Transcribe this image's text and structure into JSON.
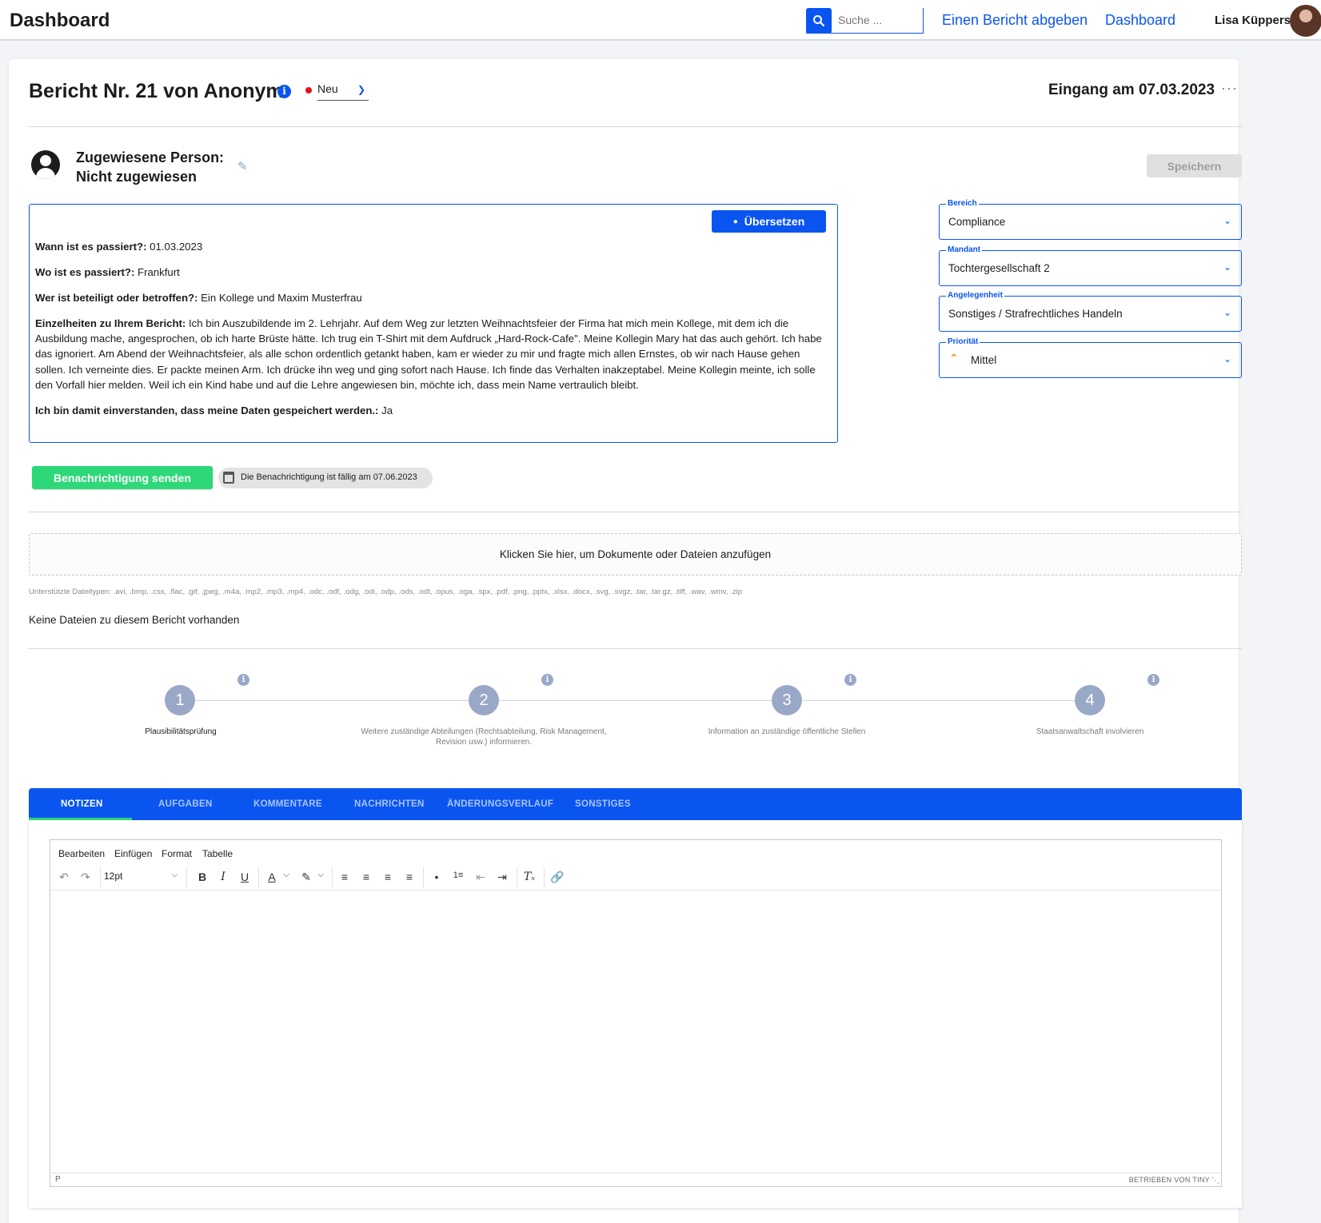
{
  "header": {
    "title": "Dashboard",
    "search_placeholder": "Suche ...",
    "nav": [
      "Einen Bericht abgeben",
      "Dashboard"
    ],
    "user_name": "Lisa Küppers"
  },
  "report": {
    "title": "Bericht Nr. 21 von Anonym",
    "status": "Neu",
    "received": "Eingang am 07.03.2023",
    "assigned_line1": "Zugewiesene Person:",
    "assigned_line2": "Nicht zugewiesen",
    "save_label": "Speichern",
    "translate_label": "Übersetzen",
    "fields": [
      {
        "label": "Wann ist es passiert?:",
        "value": " 01.03.2023"
      },
      {
        "label": "Wo ist es passiert?:",
        "value": " Frankfurt"
      },
      {
        "label": "Wer ist beteiligt oder betroffen?:",
        "value": " Ein Kollege und Maxim Musterfrau"
      },
      {
        "label": "Einzelheiten zu Ihrem Bericht:",
        "value": " Ich bin Auszubildende im 2. Lehrjahr. Auf dem Weg zur letzten Weihnachtsfeier der Firma hat mich mein Kollege, mit dem ich die Ausbildung mache, angesprochen, ob ich harte Brüste hätte. Ich trug ein T-Shirt mit dem Aufdruck „Hard-Rock-Cafe\". Meine Kollegin Mary hat das auch gehört. Ich habe das ignoriert. Am Abend der Weihnachtsfeier, als alle schon ordentlich getankt haben, kam er wieder zu mir und fragte mich allen Ernstes, ob wir nach Hause gehen sollen. Ich verneinte dies. Er packte meinen Arm. Ich drücke ihn weg und ging sofort nach Hause. Ich finde das Verhalten inakzeptabel. Meine Kollegin meinte, ich solle den Vorfall hier melden. Weil ich ein Kind habe und auf die Lehre angewiesen bin, möchte ich, dass mein Name vertraulich bleibt."
      },
      {
        "label": "Ich bin damit einverstanden, dass meine Daten gespeichert werden.:",
        "value": " Ja"
      }
    ]
  },
  "meta_fields": [
    {
      "label": "Bereich",
      "value": "Compliance"
    },
    {
      "label": "Mandant",
      "value": "Tochtergesellschaft 2"
    },
    {
      "label": "Angelegenheit",
      "value": "Sonstiges / Strafrechtliches Handeln"
    },
    {
      "label": "Priorität",
      "value": "Mittel"
    }
  ],
  "notification": {
    "button_label": "Benachrichtigung senden",
    "due_text": "Die Benachrichtigung ist fällig am 07.06.2023"
  },
  "files": {
    "upload_label": "Klicken Sie hier, um Dokumente oder Dateien anzufügen",
    "supported_types": "Unterstützte Dateitypen: .avi, .bmp, .css, .flac, .gif, .jpeg, .m4a, .mp2, .mp3, .mp4, .odc, .odf, .odg, .odi, .odp, .ods, .odt, .opus, .oga, .spx, .pdf, .png, .pptx, .xlsx, .docx, .svg, .svgz, .tar, .tar.gz, .tiff, .wav, .wmv, .zip",
    "empty_text": "Keine Dateien zu diesem Bericht vorhanden"
  },
  "steps": [
    {
      "number": "1",
      "label_lines": [
        "Plausibilitätsprüfung"
      ]
    },
    {
      "number": "2",
      "label_lines": [
        "Weitere zuständige Abteilungen (Rechtsabteilung, Risk Management,",
        "Revision usw.) informieren."
      ]
    },
    {
      "number": "3",
      "label_lines": [
        "Information an zuständige öffentliche Stellen"
      ]
    },
    {
      "number": "4",
      "label_lines": [
        "Staatsanwaltschaft involvieren"
      ]
    }
  ],
  "tabs": [
    "NOTIZEN",
    "AUFGABEN",
    "KOMMENTARE",
    "NACHRICHTEN",
    "ÄNDERUNGSVERLAUF",
    "SONSTIGES"
  ],
  "editor": {
    "menu": [
      "Bearbeiten",
      "Einfügen",
      "Format",
      "Tabelle"
    ],
    "font_size": "12pt",
    "path": "P",
    "branding": "BETRIEBEN VON TINY"
  },
  "colors": {
    "accent": "#0a55f0",
    "success": "#2ed878",
    "status_new": "#e81212",
    "priority_medium": "#f28c1e"
  }
}
